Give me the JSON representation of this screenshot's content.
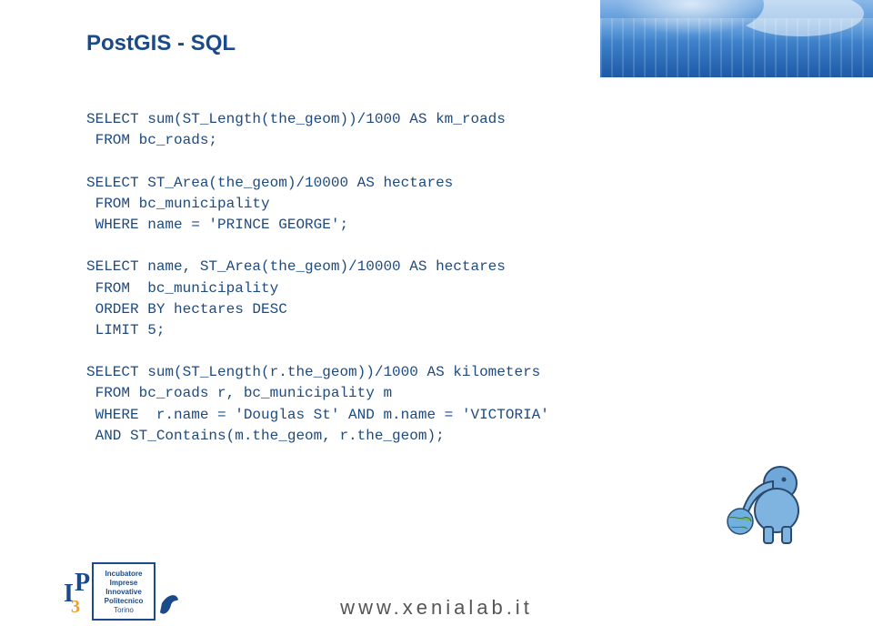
{
  "title": "PostGIS - SQL",
  "code": {
    "l1": "SELECT sum(ST_Length(the_geom))/1000 AS km_roads",
    "l2": " FROM bc_roads;",
    "l3": "",
    "l4": "SELECT ST_Area(the_geom)/10000 AS hectares",
    "l5": " FROM bc_municipality",
    "l6": " WHERE name = 'PRINCE GEORGE';",
    "l7": "",
    "l8": "SELECT name, ST_Area(the_geom)/10000 AS hectares",
    "l9": " FROM  bc_municipality",
    "l10": " ORDER BY hectares DESC",
    "l11": " LIMIT 5;",
    "l12": "",
    "l13": "SELECT sum(ST_Length(r.the_geom))/1000 AS kilometers",
    "l14": " FROM bc_roads r, bc_municipality m",
    "l15": " WHERE  r.name = 'Douglas St' AND m.name = 'VICTORIA'",
    "l16": " AND ST_Contains(m.the_geom, r.the_geom);"
  },
  "footer_url": "www.xenialab.it"
}
